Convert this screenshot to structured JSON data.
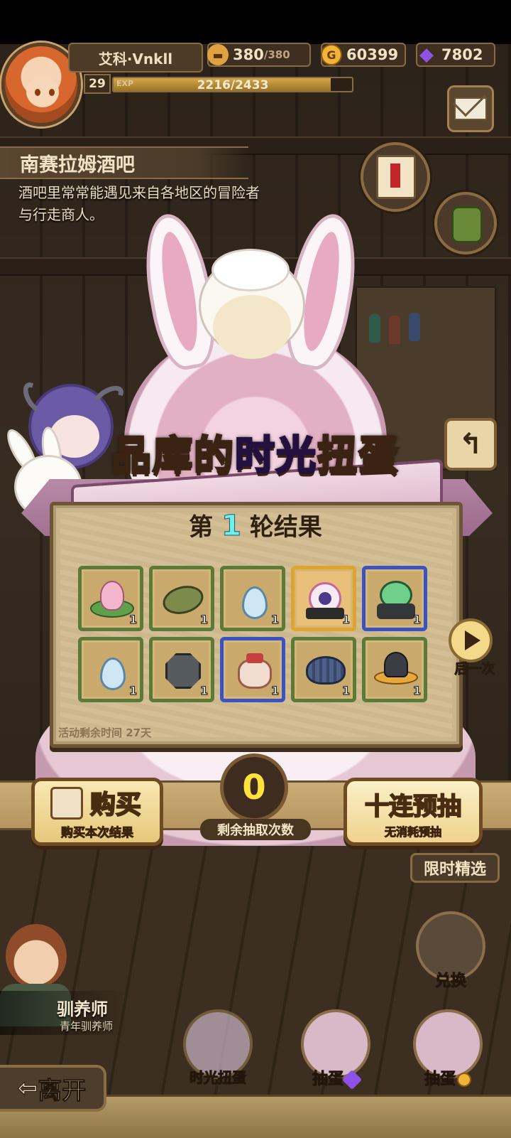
{
  "player": {
    "name": "艾科·Vnkll",
    "level": "29",
    "exp_label": "EXP",
    "exp_value": "2216/2433",
    "exp_fraction": 0.911
  },
  "resources": {
    "stamina_current": "380",
    "stamina_max": "/380",
    "gold": "60399",
    "gems": "7802"
  },
  "location": {
    "title": "南赛拉姆酒吧",
    "description": "酒吧里常常能遇见来自各地区的冒险者与行走商人。"
  },
  "event": {
    "title_part1": "品库的",
    "title_accent": "时光",
    "title_part2": "扭蛋",
    "round_prefix": "第",
    "round_number": "1",
    "round_suffix": "轮结果",
    "remaining_time": "活动剩余时间  27天",
    "next_label": "后一次"
  },
  "results": [
    {
      "item": "lotus-bud",
      "quantity": "1",
      "rarity": "blue"
    },
    {
      "item": "leaf-bundle",
      "quantity": "1",
      "rarity": "green"
    },
    {
      "item": "water-drop",
      "quantity": "1",
      "rarity": "green"
    },
    {
      "item": "heart-locket",
      "quantity": "1",
      "rarity": "gold"
    },
    {
      "item": "green-slime-ore",
      "quantity": "1",
      "rarity": "blue"
    },
    {
      "item": "water-drop",
      "quantity": "1",
      "rarity": "green"
    },
    {
      "item": "iron-ore",
      "quantity": "1",
      "rarity": "green"
    },
    {
      "item": "gift-pouch",
      "quantity": "1",
      "rarity": "blue"
    },
    {
      "item": "seashell",
      "quantity": "1",
      "rarity": "green"
    },
    {
      "item": "witch-hat",
      "quantity": "1",
      "rarity": "green"
    }
  ],
  "actions": {
    "buy_title": "购买",
    "buy_subtitle": "购买本次结果",
    "remaining_count": "0",
    "remaining_label": "剩余抽取次数",
    "ten_title": "十连预抽",
    "ten_sub_highlight": "无消耗",
    "ten_sub_rest": "预抽"
  },
  "side_menu": {
    "limited": "限时精选",
    "exchange": "兑换",
    "time_gacha": "时光扭蛋",
    "draw_gem": "抽蛋",
    "draw_gold": "抽蛋"
  },
  "npc": {
    "name": "驯养师",
    "title": "青年驯养师"
  },
  "leave": "离开",
  "colors": {
    "accent_purple": "#8d4fe0",
    "round_cyan": "#6ff0f0",
    "counter_yellow": "#ffe33c",
    "rarity_green": "#5b7a37",
    "rarity_blue": "#3b52c2",
    "rarity_gold": "#e0a32b"
  }
}
